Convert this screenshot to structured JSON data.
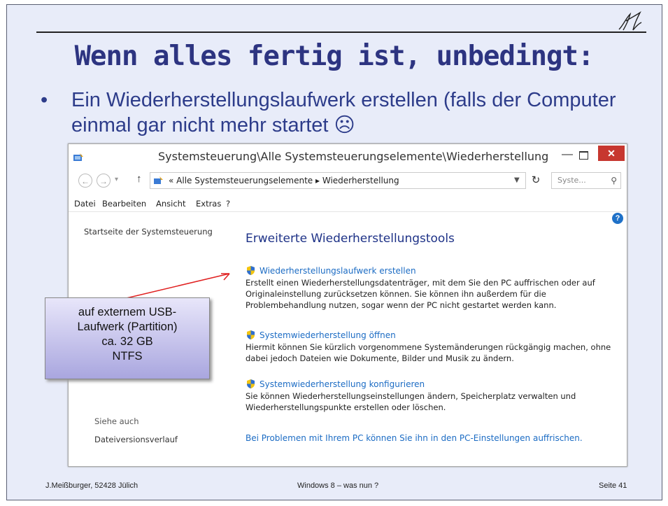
{
  "slide": {
    "title": "Wenn alles fertig ist, unbedingt:",
    "bullet": "Ein Wiederherstellungslaufwerk erstellen (falls der Computer einmal gar nicht mehr startet ☹",
    "bullet_marker": "•"
  },
  "window": {
    "title": "Systemsteuerung\\Alle Systemsteuerungselemente\\Wiederherstellung",
    "min_glyph": "—",
    "close_glyph": "✕",
    "address": {
      "crumb": "«  Alle Systemsteuerungselemente  ▸  Wiederherstellung",
      "search_placeholder": "Syste..."
    },
    "menu": [
      "Datei",
      "Bearbeiten",
      "Ansicht",
      "Extras",
      "?"
    ],
    "sidebar": {
      "home_link": "Startseite der Systemsteuerung",
      "see_also": "Siehe auch",
      "file_history": "Dateiversionsverlauf"
    },
    "heading": "Erweiterte Wiederherstellungstools",
    "tasks": [
      {
        "link": "Wiederherstellungslaufwerk erstellen",
        "desc": "Erstellt einen Wiederherstellungsdatenträger, mit dem Sie den PC auffrischen oder auf Originaleinstellung zurücksetzen können. Sie können ihn außerdem für die Problembehandlung nutzen, sogar wenn der PC nicht gestartet werden kann."
      },
      {
        "link": "Systemwiederherstellung öffnen",
        "desc": "Hiermit können Sie kürzlich vorgenommene Systemänderungen rückgängig machen, ohne dabei jedoch Dateien wie Dokumente, Bilder und Musik zu ändern."
      },
      {
        "link": "Systemwiederherstellung konfigurieren",
        "desc": "Sie können Wiederherstellungseinstellungen ändern, Speicherplatz verwalten und Wiederherstellungspunkte erstellen oder löschen."
      }
    ],
    "bottom_link": "Bei Problemen mit Ihrem PC können Sie ihn in den PC-Einstellungen auffrischen."
  },
  "callout": {
    "line1": "auf externem USB-",
    "line2": "Laufwerk (Partition)",
    "line3": "ca. 32 GB",
    "line4": "NTFS"
  },
  "footer": {
    "left": "J.Meißburger, 52428 Jülich",
    "center": "Windows 8 – was nun ?",
    "right": "Seite 41"
  },
  "colors": {
    "title": "#2d3481",
    "link": "#1c6cc4",
    "close": "#c7372f",
    "arrow": "#e02020"
  }
}
